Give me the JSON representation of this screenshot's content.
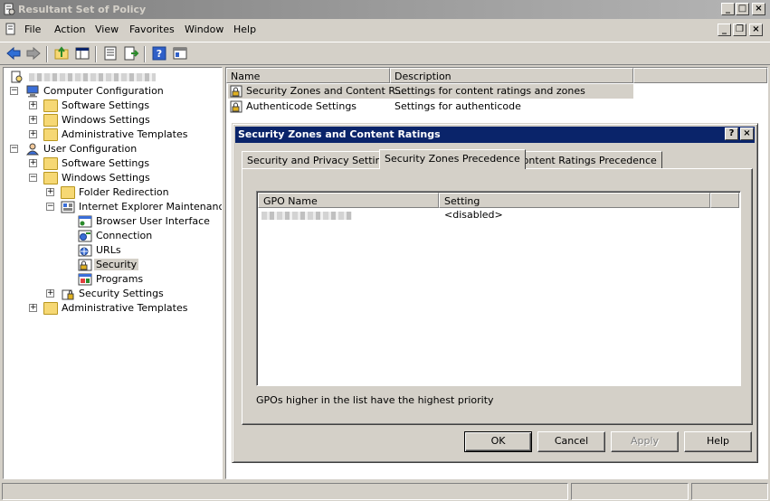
{
  "window": {
    "title": "Resultant Set of Policy"
  },
  "menu": [
    "File",
    "Action",
    "View",
    "Favorites",
    "Window",
    "Help"
  ],
  "tree": {
    "root_label": "",
    "computer_config": "Computer Configuration",
    "cc_software": "Software Settings",
    "cc_windows": "Windows Settings",
    "cc_admin": "Administrative Templates",
    "user_config": "User Configuration",
    "uc_software": "Software Settings",
    "uc_windows": "Windows Settings",
    "folder_redirection": "Folder Redirection",
    "iem": "Internet Explorer Maintenance",
    "browser_ui": "Browser User Interface",
    "connection": "Connection",
    "urls": "URLs",
    "security": "Security",
    "programs": "Programs",
    "security_settings": "Security Settings",
    "uc_admin": "Administrative Templates"
  },
  "list": {
    "col_name": "Name",
    "col_desc": "Description",
    "rows": [
      {
        "name": "Security Zones and Content R...",
        "desc": "Settings for content ratings and zones"
      },
      {
        "name": "Authenticode Settings",
        "desc": "Settings for authenticode"
      }
    ]
  },
  "dialog": {
    "title": "Security Zones and Content Ratings",
    "help": "?",
    "close": "×",
    "tabs": [
      "Security and Privacy Settings",
      "Security Zones Precedence",
      "Content Ratings Precedence"
    ],
    "col_gpo": "GPO Name",
    "col_setting": "Setting",
    "rows": [
      {
        "gpo": "",
        "setting": "<disabled>"
      }
    ],
    "note": "GPOs higher in the list have the highest priority",
    "ok": "OK",
    "cancel": "Cancel",
    "apply": "Apply",
    "helpbtn": "Help"
  }
}
